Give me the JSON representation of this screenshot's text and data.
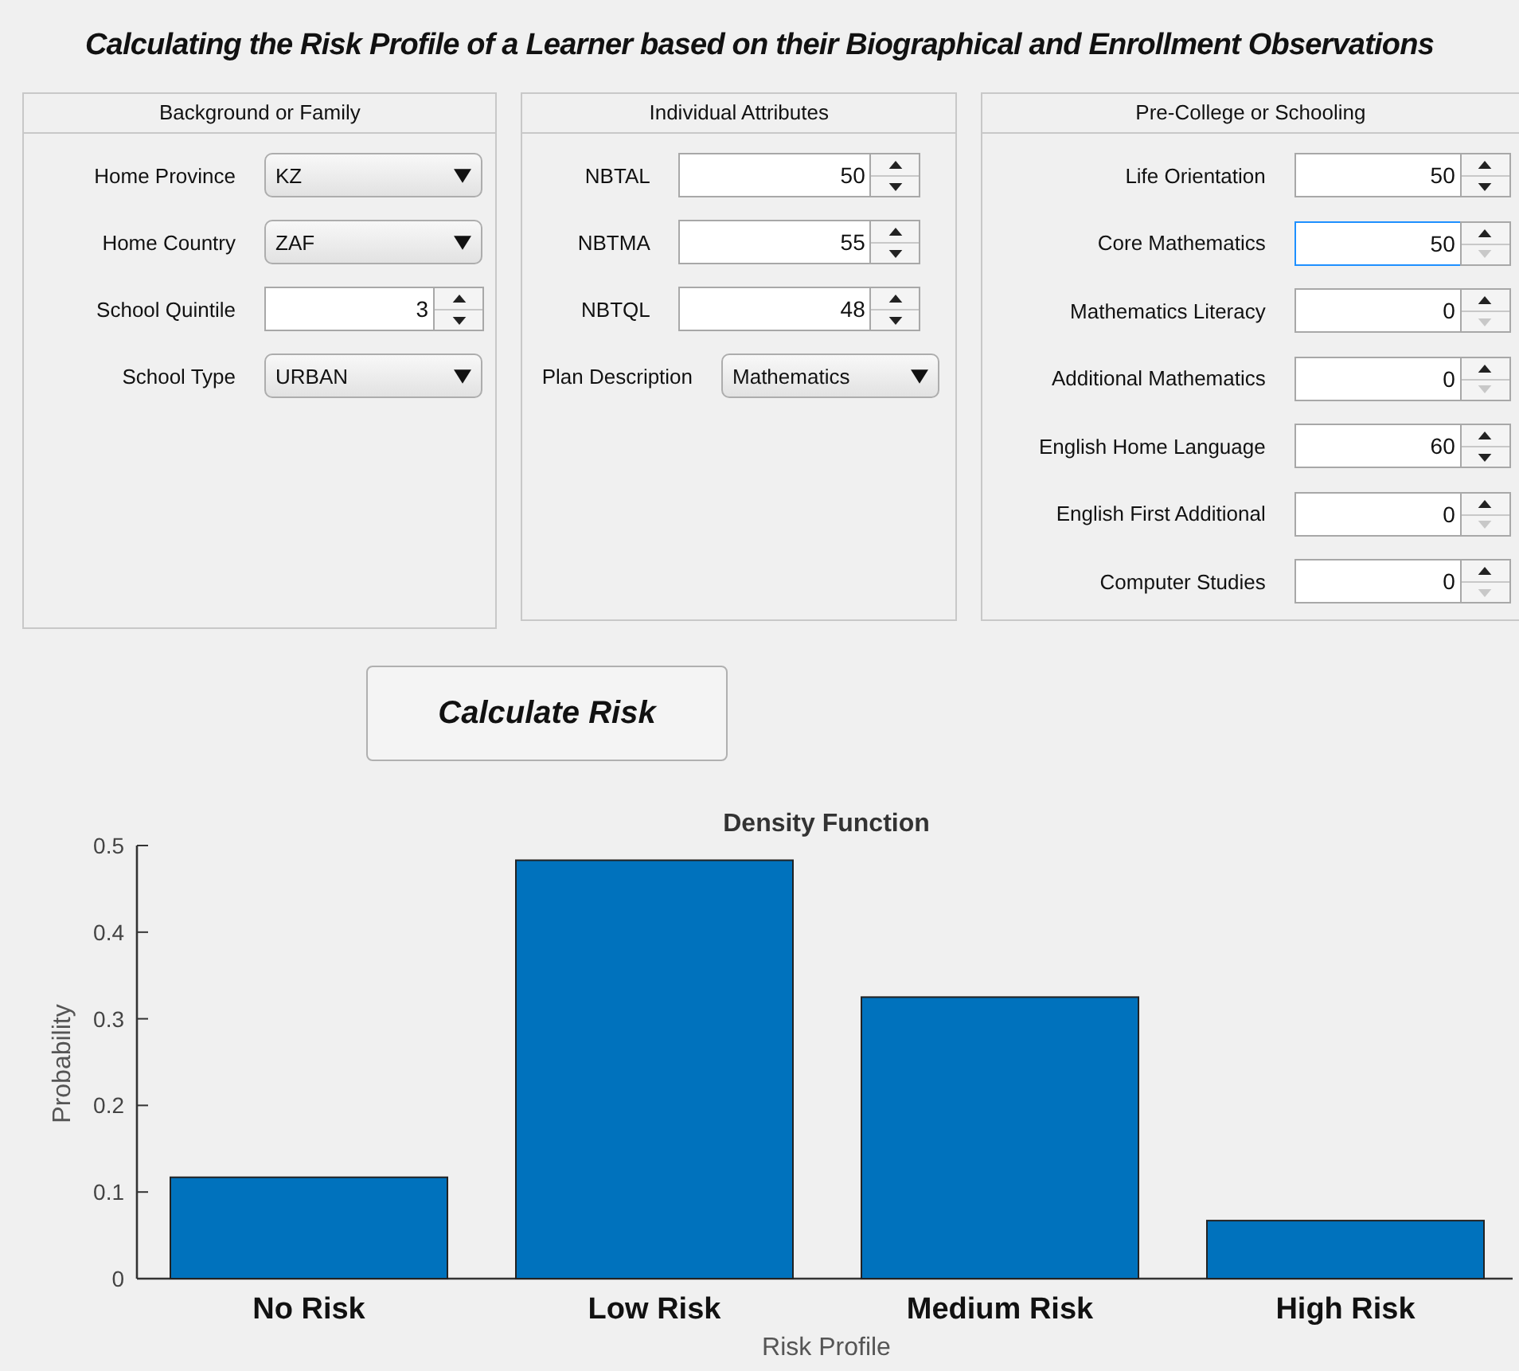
{
  "title": "Calculating the Risk Profile of a Learner based on their Biographical and Enrollment Observations",
  "panels": [
    {
      "title": "Background or Family",
      "fields": [
        {
          "kind": "dropdown",
          "label": "Home Province",
          "value": "KZ"
        },
        {
          "kind": "dropdown",
          "label": "Home Country",
          "value": "ZAF"
        },
        {
          "kind": "spinner",
          "label": "School Quintile",
          "value": "3",
          "focused": false,
          "down_disabled": false
        },
        {
          "kind": "dropdown",
          "label": "School Type",
          "value": "URBAN"
        }
      ]
    },
    {
      "title": "Individual Attributes",
      "fields": [
        {
          "kind": "spinner",
          "label": "NBTAL",
          "value": "50",
          "focused": false,
          "down_disabled": false
        },
        {
          "kind": "spinner",
          "label": "NBTMA",
          "value": "55",
          "focused": false,
          "down_disabled": false
        },
        {
          "kind": "spinner",
          "label": "NBTQL",
          "value": "48",
          "focused": false,
          "down_disabled": false
        },
        {
          "kind": "dropdown",
          "label": "Plan Description",
          "value": "Mathematics"
        }
      ]
    },
    {
      "title": "Pre-College or Schooling",
      "fields": [
        {
          "kind": "spinner",
          "label": "Life Orientation",
          "value": "50",
          "focused": false,
          "down_disabled": false
        },
        {
          "kind": "spinner",
          "label": "Core Mathematics",
          "value": "50",
          "focused": true,
          "down_disabled": true
        },
        {
          "kind": "spinner",
          "label": "Mathematics Literacy",
          "value": "0",
          "focused": false,
          "down_disabled": true
        },
        {
          "kind": "spinner",
          "label": "Additional Mathematics",
          "value": "0",
          "focused": false,
          "down_disabled": true
        },
        {
          "kind": "spinner",
          "label": "English Home Language",
          "value": "60",
          "focused": false,
          "down_disabled": false
        },
        {
          "kind": "spinner",
          "label": "English First Additional",
          "value": "0",
          "focused": false,
          "down_disabled": true
        },
        {
          "kind": "spinner",
          "label": "Computer Studies",
          "value": "0",
          "focused": false,
          "down_disabled": true
        }
      ]
    }
  ],
  "button": {
    "label": "Calculate Risk"
  },
  "chart_data": {
    "type": "bar",
    "title": "Density Function",
    "xlabel": "Risk Profile",
    "ylabel": "Probability",
    "categories": [
      "No Risk",
      "Low Risk",
      "Medium Risk",
      "High Risk"
    ],
    "series": [
      {
        "color": "#0072bd",
        "values": [
          0.117,
          0.483,
          0.325,
          0.067
        ]
      }
    ],
    "ylim": [
      0,
      0.5
    ],
    "yticks": [
      0,
      0.1,
      0.2,
      0.3,
      0.4,
      0.5
    ]
  }
}
